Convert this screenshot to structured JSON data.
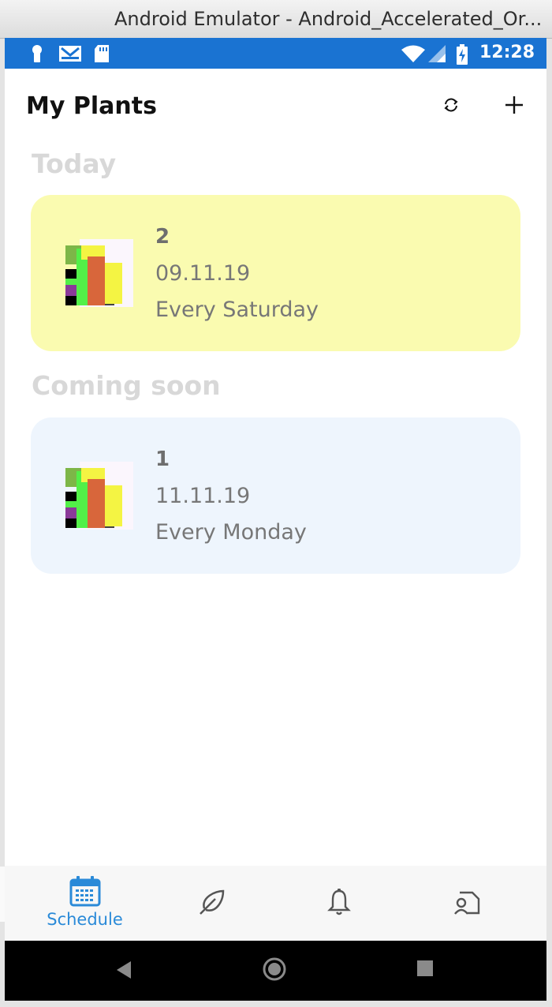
{
  "window": {
    "title": "Android Emulator - Android_Accelerated_Or..."
  },
  "status_bar": {
    "time": "12:28",
    "left_icons": [
      "person-pin-icon",
      "mail-icon",
      "sd-card-icon"
    ],
    "right_icons": [
      "wifi-icon",
      "signal-icon",
      "battery-charging-icon"
    ],
    "color": "#1a73d2"
  },
  "app_bar": {
    "title": "My Plants",
    "actions": [
      "refresh-icon",
      "add-icon"
    ]
  },
  "sections": [
    {
      "header": "Today",
      "plants": [
        {
          "name": "2",
          "date": "09.11.19",
          "repeat": "Every Saturday",
          "card_color": "#fafbb0"
        }
      ]
    },
    {
      "header": "Coming soon",
      "plants": [
        {
          "name": "1",
          "date": "11.11.19",
          "repeat": "Every Monday",
          "card_color": "#eef5fd"
        }
      ]
    }
  ],
  "tab_bar": {
    "tabs": [
      {
        "label": "Schedule",
        "icon": "calendar-icon",
        "selected": true
      },
      {
        "label": "",
        "icon": "leaf-icon",
        "selected": false
      },
      {
        "label": "",
        "icon": "bell-icon",
        "selected": false
      },
      {
        "label": "",
        "icon": "profile-icon",
        "selected": false
      }
    ],
    "active_color": "#2a8ad8"
  },
  "nav_bar": {
    "buttons": [
      "back-icon",
      "home-icon",
      "recents-icon"
    ]
  }
}
